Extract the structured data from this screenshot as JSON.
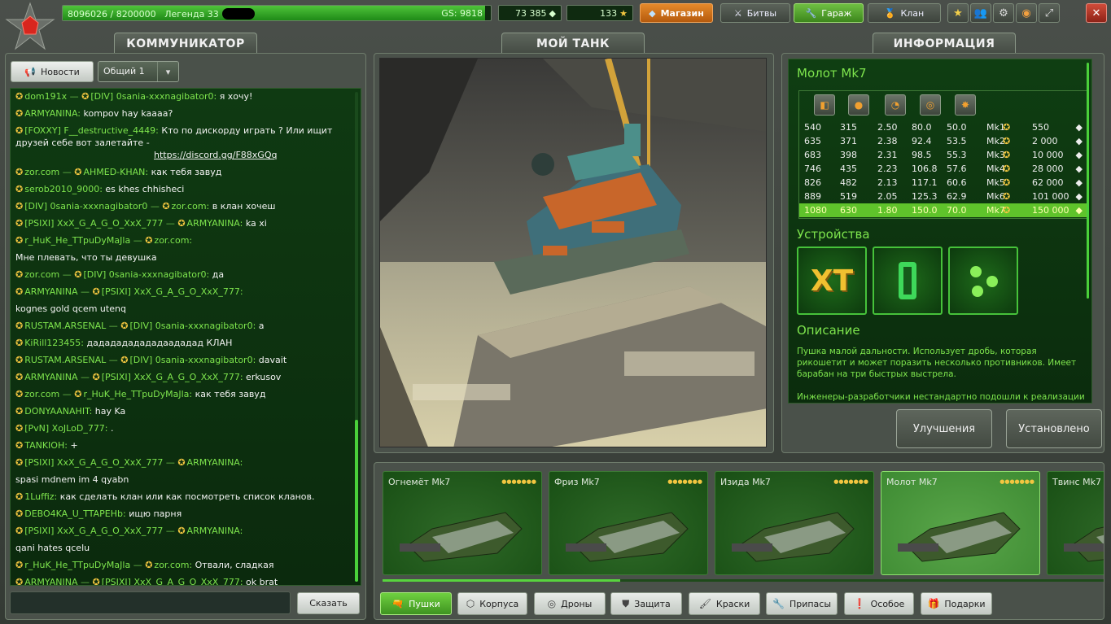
{
  "topbar": {
    "xp_text": "8096026 / 8200000",
    "rank_text": "Легенда 33",
    "xp_fraction": 0.987,
    "gs_text": "GS: 9818",
    "crystals": "73 385",
    "stars": "133",
    "shop_label": "Магазин",
    "battles_label": "Битвы",
    "garage_label": "Гараж",
    "clan_label": "Клан"
  },
  "panels": {
    "communicator": "КОММУНИКАТОР",
    "my_tank": "МОЙ ТАНК",
    "info": "ИНФОРМАЦИЯ"
  },
  "chat": {
    "news_label": "Новости",
    "channel": "Общий 1",
    "send_label": "Сказать",
    "scroll_fraction": 0.33,
    "messages": [
      {
        "from": "dom191x",
        "sep": " — ",
        "to": "[DIV] 0sania-xxxnagibator0:",
        "text": "я хочу!"
      },
      {
        "from": "ARMYANINA:",
        "text": "kompov hay kaaaa?"
      },
      {
        "from": "[FOXXY] F__destructive_4449:",
        "text": "Кто по дискорду играть ? Или ищит друзей себе вот залетайте -",
        "link": "https://discord.gg/F88xGQq"
      },
      {
        "from": "zor.com",
        "sep": " — ",
        "to": "AHMED-KHAN:",
        "text": "как тебя завуд"
      },
      {
        "from": "serob2010_9000:",
        "text": "es khes chhisheci"
      },
      {
        "from": "[DIV] 0sania-xxxnagibator0",
        "sep": " — ",
        "to": "zor.com:",
        "text": "в клан хочеш"
      },
      {
        "from": "[PSIXI] XxX_G_A_G_O_XxX_777",
        "sep": " — ",
        "to": "ARMYANINA:",
        "text": "ka xi"
      },
      {
        "from": "r_HuK_He_TTpuDyMaJla",
        "sep": " — ",
        "to": "zor.com:",
        "text": ""
      },
      {
        "from": "",
        "text": "Мне плевать, что ты девушка"
      },
      {
        "from": "zor.com",
        "sep": " — ",
        "to": "[DIV] 0sania-xxxnagibator0:",
        "text": "да"
      },
      {
        "from": "ARMYANINA",
        "sep": " — ",
        "to": "[PSIXI] XxX_G_A_G_O_XxX_777:",
        "text": ""
      },
      {
        "from": "",
        "text": "kognes gold qcem utenq"
      },
      {
        "from": "RUSTAM.ARSENAL",
        "sep": " — ",
        "to": "[DIV] 0sania-xxxnagibator0:",
        "text": "a"
      },
      {
        "from": "KiRill123455:",
        "text": "дададададададаададад КЛАН"
      },
      {
        "from": "RUSTAM.ARSENAL",
        "sep": " — ",
        "to": "[DIV] 0sania-xxxnagibator0:",
        "text": "davait"
      },
      {
        "from": "ARMYANINA",
        "sep": " — ",
        "to": "[PSIXI] XxX_G_A_G_O_XxX_777:",
        "text": "erkusov"
      },
      {
        "from": "zor.com",
        "sep": " — ",
        "to": "r_HuK_He_TTpuDyMaJla:",
        "text": "как тебя завуд"
      },
      {
        "from": "DONYAANAHIT:",
        "text": "hay Ka"
      },
      {
        "from": "[PvN] XoJLoD_777:",
        "text": "."
      },
      {
        "from": "TANKIOH:",
        "text": "+"
      },
      {
        "from": "[PSIXI] XxX_G_A_G_O_XxX_777",
        "sep": " — ",
        "to": "ARMYANINA:",
        "text": ""
      },
      {
        "from": "",
        "text": "spasi mdnem im 4 qyabn"
      },
      {
        "from": "1Luffiz:",
        "text": "как сделать клан или как посмотреть список кланов."
      },
      {
        "from": "DEBO4KA_U_TTAPEHb:",
        "text": "ищю парня"
      },
      {
        "from": "[PSIXI] XxX_G_A_G_O_XxX_777",
        "sep": " — ",
        "to": "ARMYANINA:",
        "text": ""
      },
      {
        "from": "",
        "text": "qani hates qcelu"
      },
      {
        "from": "r_HuK_He_TTpuDyMaJla",
        "sep": " — ",
        "to": "zor.com:",
        "text": "Отвали, сладкая"
      },
      {
        "from": "ARMYANINA",
        "sep": " — ",
        "to": "[PSIXI] XxX_G_A_G_O_XxX_777:",
        "text": "ok brat"
      }
    ]
  },
  "info": {
    "title": "Молот Mk7",
    "stats_rows": [
      {
        "a": "540",
        "b": "315",
        "c": "2.50",
        "d": "80.0",
        "e": "50.0",
        "mk": "Mk1",
        "price": "550"
      },
      {
        "a": "635",
        "b": "371",
        "c": "2.38",
        "d": "92.4",
        "e": "53.5",
        "mk": "Mk2",
        "price": "2 000"
      },
      {
        "a": "683",
        "b": "398",
        "c": "2.31",
        "d": "98.5",
        "e": "55.3",
        "mk": "Mk3",
        "price": "10 000"
      },
      {
        "a": "746",
        "b": "435",
        "c": "2.23",
        "d": "106.8",
        "e": "57.6",
        "mk": "Mk4",
        "price": "28 000"
      },
      {
        "a": "826",
        "b": "482",
        "c": "2.13",
        "d": "117.1",
        "e": "60.6",
        "mk": "Mk5",
        "price": "62 000"
      },
      {
        "a": "889",
        "b": "519",
        "c": "2.05",
        "d": "125.3",
        "e": "62.9",
        "mk": "Mk6",
        "price": "101 000"
      },
      {
        "a": "1080",
        "b": "630",
        "c": "1.80",
        "d": "150.0",
        "e": "70.0",
        "mk": "Mk7",
        "price": "150 000"
      }
    ],
    "devices_title": "Устройства",
    "device_xt": "XT",
    "description_title": "Описание",
    "description": "Пушка малой дальности. Использует дробь, которая рикошетит и может поразить несколько противников. Имеет барабан на три быстрых выстрела.",
    "description_more": "Инженеры-разработчики нестандартно подошли к реализации этой",
    "upgrade_label": "Улучшения",
    "installed_label": "Установлено"
  },
  "items": [
    {
      "name": "Огнемёт Mk7"
    },
    {
      "name": "Фриз Mk7"
    },
    {
      "name": "Изида Mk7"
    },
    {
      "name": "Молот Mk7"
    },
    {
      "name": "Твинс Mk7"
    }
  ],
  "items_scroll_fraction": 0.33,
  "categories": [
    {
      "label": "Пушки"
    },
    {
      "label": "Корпуса"
    },
    {
      "label": "Дроны"
    },
    {
      "label": "Защита"
    },
    {
      "label": "Краски"
    },
    {
      "label": "Припасы"
    },
    {
      "label": "Особое"
    },
    {
      "label": "Подарки"
    }
  ],
  "colors": {
    "accent_green": "#7ee54d",
    "shop_orange": "#e58a2b",
    "garage_green": "#6fbf43"
  }
}
